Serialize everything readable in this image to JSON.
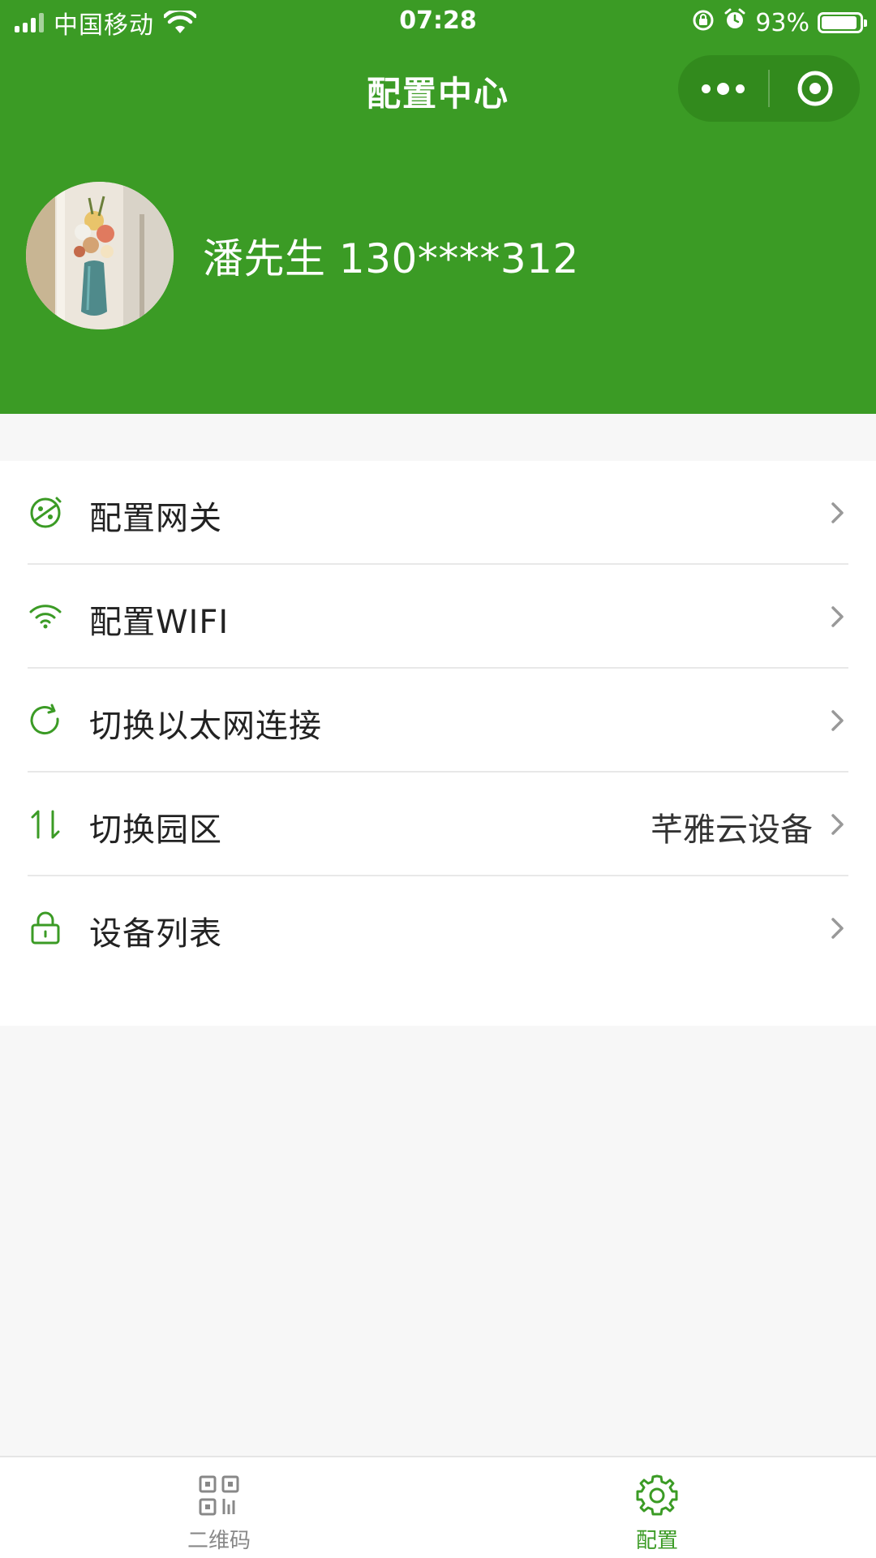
{
  "status_bar": {
    "carrier": "中国移动",
    "time": "07:28",
    "battery": "93%",
    "battery_level": 0.93
  },
  "nav": {
    "title": "配置中心",
    "more_icon": "more-dots-icon",
    "close_icon": "target-circle-icon"
  },
  "profile": {
    "name": "潘先生 130****312",
    "avatar_icon": "user-avatar"
  },
  "colors": {
    "brand_green": "#3b9b25",
    "capsule_green": "#328a1d",
    "text_dark": "#222222",
    "separator": "#e8e8e8",
    "background": "#f7f7f7"
  },
  "menu": {
    "items": [
      {
        "label": "配置网关",
        "icon": "gateway-icon",
        "value": ""
      },
      {
        "label": "配置WIFI",
        "icon": "wifi-icon",
        "value": ""
      },
      {
        "label": "切换以太网连接",
        "icon": "refresh-icon",
        "value": ""
      },
      {
        "label": "切换园区",
        "icon": "switch-arrows-icon",
        "value": "芊雅云设备"
      },
      {
        "label": "设备列表",
        "icon": "lock-icon",
        "value": ""
      }
    ]
  },
  "tabbar": {
    "tabs": [
      {
        "label": "二维码",
        "icon": "qrcode-icon",
        "active": false
      },
      {
        "label": "配置",
        "icon": "gear-icon",
        "active": true
      }
    ]
  }
}
